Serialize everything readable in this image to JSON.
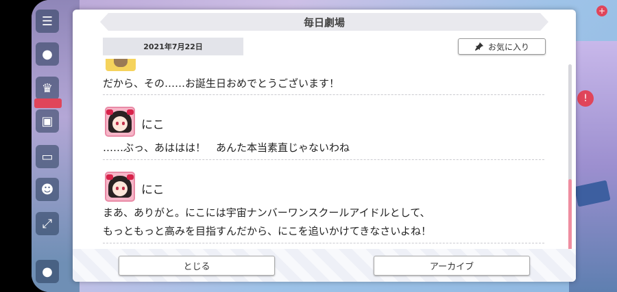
{
  "modal": {
    "title": "毎日劇場",
    "date": "2021年7月22日",
    "favorite_label": "お気に入り",
    "close_label": "とじる",
    "archive_label": "アーカイブ"
  },
  "dialogue": [
    {
      "speaker": "",
      "lines": [
        "だから、その……お誕生日おめでとうございます！"
      ]
    },
    {
      "speaker": "にこ",
      "lines": [
        "……ぶっ、あははは！　あんた本当素直じゃないわね"
      ]
    },
    {
      "speaker": "にこ",
      "lines": [
        "まあ、ありがと。にこには宇宙ナンバーワンスクールアイドルとして、",
        "もっともっと高みを目指すんだから、にこを追いかけてきなさいよね！"
      ]
    }
  ],
  "icons": {
    "menu": "menu-icon",
    "pin": "pin-icon"
  },
  "colors": {
    "scroll_thumb": "#ef8ea0",
    "avatar_border": "#e98aa6"
  }
}
